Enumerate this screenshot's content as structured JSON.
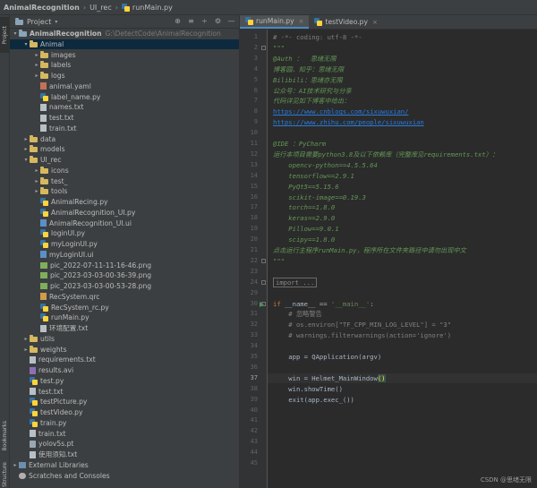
{
  "titlebar": {
    "project": "AnimalRecognition",
    "folder": "UI_rec",
    "file": "runMain.py"
  },
  "left_toolbar": {
    "project_tab": "Project",
    "bookmarks_tab": "Bookmarks",
    "structure_tab": "Structure"
  },
  "project_panel": {
    "title": "Project",
    "tools": [
      "⊕",
      "≡",
      "÷",
      "⚙",
      "—"
    ],
    "rows": [
      {
        "label": "AnimalRecognition",
        "path": "G:\\DetectCode\\AnimalRecognition",
        "icon": "folder",
        "depth": 0,
        "arrow": "▾",
        "bold": true
      },
      {
        "label": "Animal",
        "icon": "folder",
        "depth": 1,
        "arrow": "▾",
        "selected": true
      },
      {
        "label": "images",
        "icon": "folder",
        "depth": 2,
        "arrow": "▸"
      },
      {
        "label": "labels",
        "icon": "folder",
        "depth": 2,
        "arrow": "▸"
      },
      {
        "label": "logs",
        "icon": "folder",
        "depth": 2,
        "arrow": "▸"
      },
      {
        "label": "animal.yaml",
        "icon": "yaml",
        "depth": 2
      },
      {
        "label": "label_name.py",
        "icon": "py",
        "depth": 2
      },
      {
        "label": "names.txt",
        "icon": "txt",
        "depth": 2
      },
      {
        "label": "test.txt",
        "icon": "txt",
        "depth": 2
      },
      {
        "label": "train.txt",
        "icon": "txt",
        "depth": 2
      },
      {
        "label": "data",
        "icon": "folder",
        "depth": 1,
        "arrow": "▸"
      },
      {
        "label": "models",
        "icon": "folder",
        "depth": 1,
        "arrow": "▸"
      },
      {
        "label": "UI_rec",
        "icon": "folder",
        "depth": 1,
        "arrow": "▾"
      },
      {
        "label": "icons",
        "icon": "folder",
        "depth": 2,
        "arrow": "▸"
      },
      {
        "label": "test_",
        "icon": "folder",
        "depth": 2,
        "arrow": "▸"
      },
      {
        "label": "tools",
        "icon": "folder",
        "depth": 2,
        "arrow": "▸"
      },
      {
        "label": "AnimalRecing.py",
        "icon": "py",
        "depth": 2
      },
      {
        "label": "AnimalRecognition_UI.py",
        "icon": "py",
        "depth": 2
      },
      {
        "label": "AnimalRecognition_UI.ui",
        "icon": "ui",
        "depth": 2
      },
      {
        "label": "loginUI.py",
        "icon": "py",
        "depth": 2
      },
      {
        "label": "myLoginUI.py",
        "icon": "py",
        "depth": 2
      },
      {
        "label": "myLoginUI.ui",
        "icon": "ui",
        "depth": 2
      },
      {
        "label": "pic_2022-07-11-11-16-46.png",
        "icon": "img",
        "depth": 2
      },
      {
        "label": "pic_2023-03-03-00-36-39.png",
        "icon": "img",
        "depth": 2
      },
      {
        "label": "pic_2023-03-03-00-53-28.png",
        "icon": "img",
        "depth": 2
      },
      {
        "label": "RecSystem.qrc",
        "icon": "qrc",
        "depth": 2
      },
      {
        "label": "RecSystem_rc.py",
        "icon": "py",
        "depth": 2
      },
      {
        "label": "runMain.py",
        "icon": "py",
        "depth": 2
      },
      {
        "label": "环境配置.txt",
        "icon": "txt",
        "depth": 2
      },
      {
        "label": "utils",
        "icon": "folder",
        "depth": 1,
        "arrow": "▸"
      },
      {
        "label": "weights",
        "icon": "folder",
        "depth": 1,
        "arrow": "▸"
      },
      {
        "label": "requirements.txt",
        "icon": "txt",
        "depth": 1
      },
      {
        "label": "results.avi",
        "icon": "avi",
        "depth": 1
      },
      {
        "label": "test.py",
        "icon": "py",
        "depth": 1
      },
      {
        "label": "test.txt",
        "icon": "txt",
        "depth": 1
      },
      {
        "label": "testPicture.py",
        "icon": "py",
        "depth": 1
      },
      {
        "label": "testVideo.py",
        "icon": "py",
        "depth": 1
      },
      {
        "label": "train.py",
        "icon": "py",
        "depth": 1
      },
      {
        "label": "train.txt",
        "icon": "txt",
        "depth": 1
      },
      {
        "label": "yolov5s.pt",
        "icon": "file",
        "depth": 1
      },
      {
        "label": "使用须知.txt",
        "icon": "txt",
        "depth": 1
      },
      {
        "label": "External Libraries",
        "icon": "lib",
        "depth": 0,
        "arrow": "▸"
      },
      {
        "label": "Scratches and Consoles",
        "icon": "scratch",
        "depth": 0
      }
    ]
  },
  "editor": {
    "tabs": [
      {
        "label": "runMain.py",
        "active": true
      },
      {
        "label": "testVideo.py",
        "active": false
      }
    ],
    "current_line": 37,
    "lines": [
      {
        "n": 1,
        "html": [
          [
            "cmt",
            "# -*- coding: utf-8 -*-"
          ]
        ]
      },
      {
        "n": 2,
        "html": [
          [
            "doc",
            "\"\"\""
          ]
        ]
      },
      {
        "n": 3,
        "html": [
          [
            "doc",
            "@Auth ：  思绪无限"
          ]
        ]
      },
      {
        "n": 4,
        "html": [
          [
            "doc",
            "博客园、知乎：思绪无限"
          ]
        ]
      },
      {
        "n": 5,
        "html": [
          [
            "doc",
            "Bilibili：思绪亦无限"
          ]
        ]
      },
      {
        "n": 6,
        "html": [
          [
            "doc",
            "公众号：AI技术研究与分享"
          ]
        ]
      },
      {
        "n": 7,
        "html": [
          [
            "doc",
            "代码详见如下博客中给出："
          ]
        ]
      },
      {
        "n": 8,
        "html": [
          [
            "link",
            "https://www.cnblogs.com/sixuwuxian/"
          ]
        ]
      },
      {
        "n": 9,
        "html": [
          [
            "link",
            "https://www.zhihu.com/people/sixuwuxian"
          ]
        ]
      },
      {
        "n": 10,
        "html": []
      },
      {
        "n": 11,
        "html": [
          [
            "doc",
            "@IDE ：PyCharm"
          ]
        ]
      },
      {
        "n": 12,
        "html": [
          [
            "doc",
            "运行本项目需要python3.8及以下依赖库（完整库见requirements.txt）："
          ]
        ]
      },
      {
        "n": 13,
        "html": [
          [
            "doc",
            "    opencv-python==4.5.5.64"
          ]
        ]
      },
      {
        "n": 14,
        "html": [
          [
            "doc",
            "    tensorflow==2.9.1"
          ]
        ]
      },
      {
        "n": 15,
        "html": [
          [
            "doc",
            "    PyQt5==5.15.6"
          ]
        ]
      },
      {
        "n": 16,
        "html": [
          [
            "doc",
            "    scikit-image==0.19.3"
          ]
        ]
      },
      {
        "n": 17,
        "html": [
          [
            "doc",
            "    torch==1.8.0"
          ]
        ]
      },
      {
        "n": 18,
        "html": [
          [
            "doc",
            "    keras==2.9.0"
          ]
        ]
      },
      {
        "n": 19,
        "html": [
          [
            "doc",
            "    Pillow==9.0.1"
          ]
        ]
      },
      {
        "n": 20,
        "html": [
          [
            "doc",
            "    scipy==1.8.0"
          ]
        ]
      },
      {
        "n": 21,
        "html": [
          [
            "doc",
            "点击运行主程序runMain.py，程序所在文件夹路径中请勿出现中文"
          ]
        ]
      },
      {
        "n": 22,
        "html": [
          [
            "doc",
            "\"\"\""
          ]
        ]
      },
      {
        "n": 23,
        "html": []
      },
      {
        "n": 24,
        "html": [
          [
            "fold",
            "import ..."
          ]
        ]
      },
      {
        "n": 29,
        "html": []
      },
      {
        "n": 30,
        "html": [
          [
            "kw",
            "if "
          ],
          [
            "",
            "__name__ == "
          ],
          [
            "str",
            "'__main__'"
          ],
          [
            "",
            ":"
          ]
        ]
      },
      {
        "n": 31,
        "html": [
          [
            "cmt",
            "    # 忽略警告"
          ]
        ]
      },
      {
        "n": 32,
        "html": [
          [
            "cmt",
            "    # os.environ[\"TF_CPP_MIN_LOG_LEVEL\"] = \"3\""
          ]
        ]
      },
      {
        "n": 33,
        "html": [
          [
            "cmt",
            "    # warnings.filterwarnings(action='ignore')"
          ]
        ]
      },
      {
        "n": 34,
        "html": []
      },
      {
        "n": 35,
        "html": [
          [
            "",
            "    app = QApplication(argv)"
          ]
        ]
      },
      {
        "n": 36,
        "html": []
      },
      {
        "n": 37,
        "html": [
          [
            "",
            "    win = Helmet_MainWindow"
          ],
          [
            "bracket",
            "()"
          ]
        ]
      },
      {
        "n": 38,
        "html": [
          [
            "",
            "    win.showTime()"
          ]
        ]
      },
      {
        "n": 39,
        "html": [
          [
            "",
            "    exit(app.exec_())"
          ]
        ]
      },
      {
        "n": 40,
        "html": []
      },
      {
        "n": 41,
        "html": []
      },
      {
        "n": 42,
        "html": []
      },
      {
        "n": 43,
        "html": []
      },
      {
        "n": 44,
        "html": []
      },
      {
        "n": 45,
        "html": []
      }
    ]
  },
  "watermark": "CSDN @思绪无限"
}
